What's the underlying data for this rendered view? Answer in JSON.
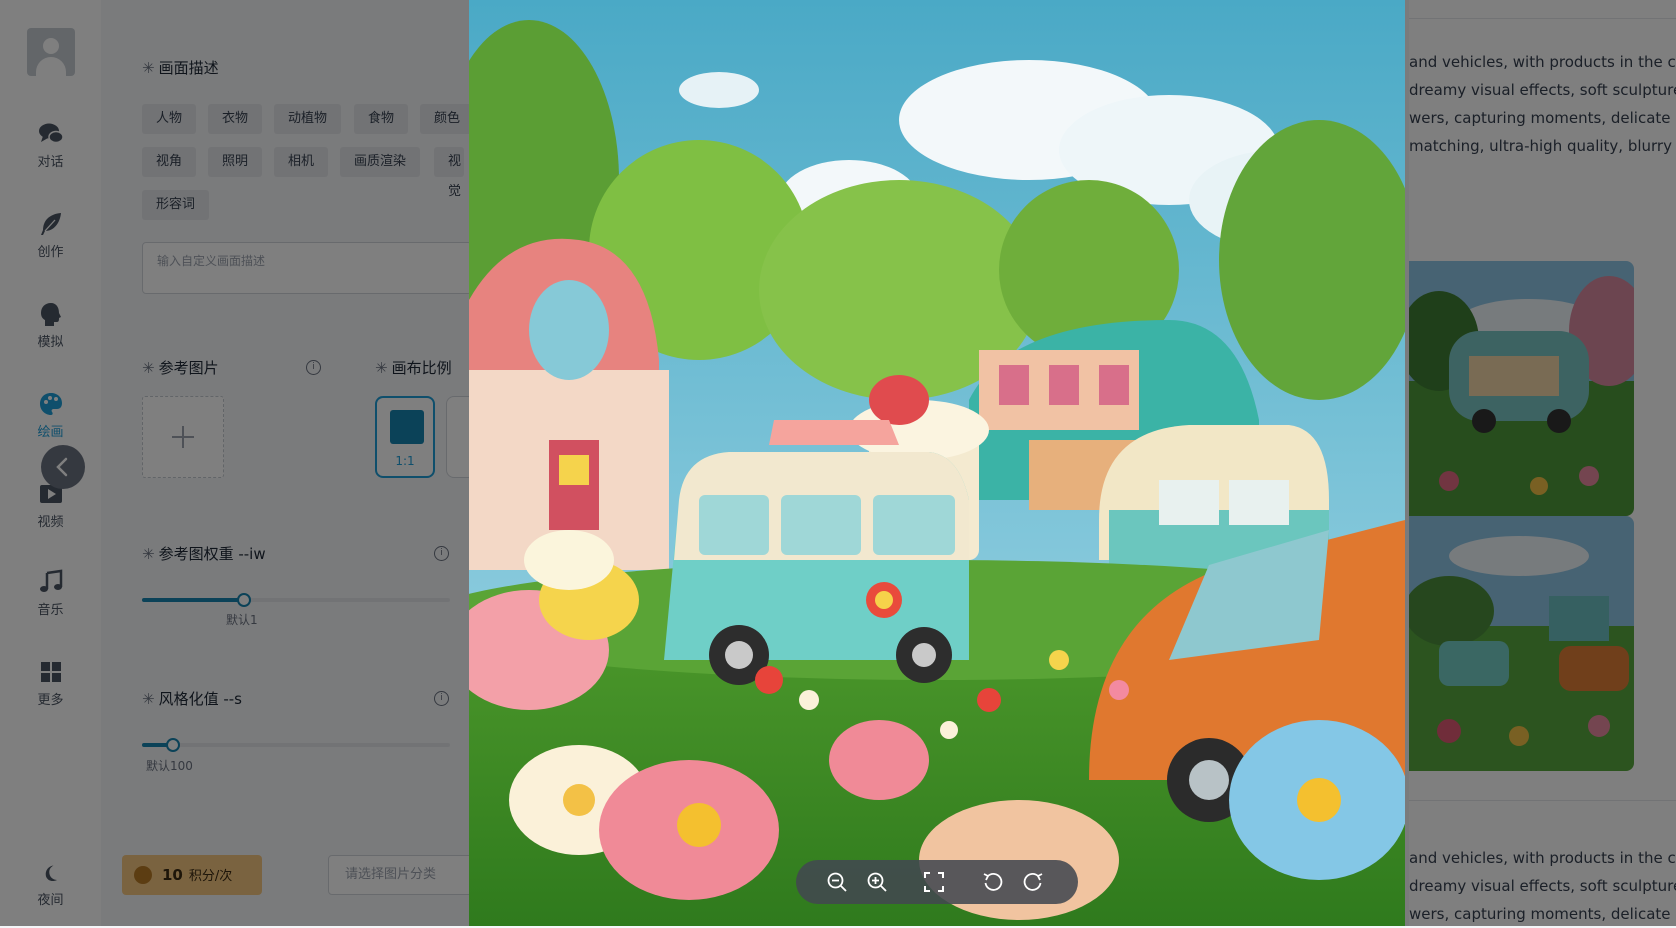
{
  "sidebar": {
    "items": [
      {
        "label": "对话",
        "icon": "chat-bubbles-icon"
      },
      {
        "label": "创作",
        "icon": "feather-icon"
      },
      {
        "label": "模拟",
        "icon": "head-profile-icon"
      },
      {
        "label": "绘画",
        "icon": "palette-icon",
        "active": true
      },
      {
        "label": "视频",
        "icon": "video-play-icon"
      },
      {
        "label": "音乐",
        "icon": "music-note-icon"
      },
      {
        "label": "更多",
        "icon": "grid-icon"
      }
    ],
    "night_label": "夜间"
  },
  "form": {
    "description_title": "画面描述",
    "tags_row1": [
      "人物",
      "衣物",
      "动植物",
      "食物",
      "颜色"
    ],
    "tags_row2": [
      "视角",
      "照明",
      "相机",
      "画质渲染",
      "视觉"
    ],
    "tags_row3": [
      "形容词"
    ],
    "custom_placeholder": "输入自定义画面描述",
    "reference_title": "参考图片",
    "ratio_title": "画布比例",
    "ratio_selected": "1:1",
    "weight_title": "参考图权重 --iw",
    "weight_default": "默认1",
    "weight_value_fraction": 0.33,
    "stylize_title": "风格化值 --s",
    "stylize_default": "默认100",
    "stylize_value_fraction": 0.1,
    "points_amount": "10",
    "points_unit": "积分/次",
    "category_placeholder": "请选择图片分类"
  },
  "results": {
    "desc_lines": [
      "and vehicles, with products in the ca",
      "dreamy visual effects, soft sculpture",
      "wers, capturing moments, delicate l",
      "matching, ultra-high quality, blurry f"
    ],
    "desc_lines_2": [
      "and vehicles, with products in the ca",
      "dreamy visual effects, soft sculpture",
      "wers, capturing moments, delicate l"
    ]
  },
  "viewer": {
    "toolbar": [
      "zoom-out-icon",
      "zoom-in-icon",
      "fullscreen-icon",
      "rotate-left-icon",
      "rotate-right-icon"
    ]
  },
  "colors": {
    "accent": "#1f9ed8",
    "points_bg": "#f5c781"
  }
}
